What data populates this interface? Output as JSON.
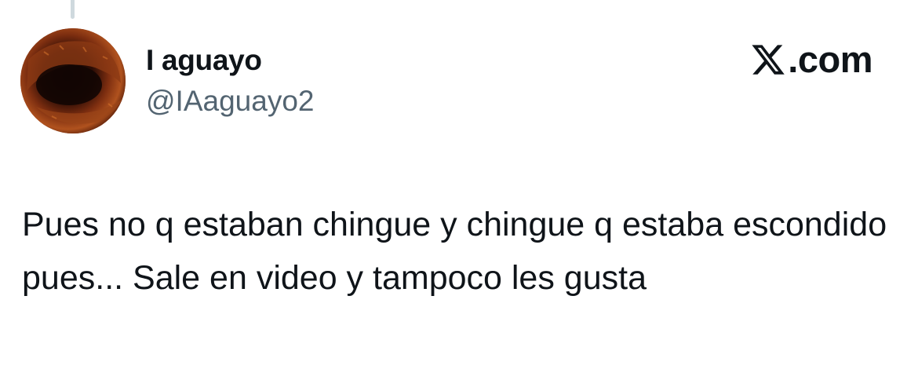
{
  "tweet": {
    "author": {
      "display_name": "I aguayo",
      "handle": "@IAaguayo2",
      "avatar_icon": "avatar-image"
    },
    "brand": {
      "logo_icon": "x-logo-icon",
      "suffix": ".com"
    },
    "text": "Pues no q estaban chingue y chingue q estaba escondido pues... Sale en video y tampoco les gusta"
  },
  "colors": {
    "text_primary": "#0f1419",
    "text_secondary": "#536471",
    "thread_line": "#cfd9de",
    "background": "#ffffff"
  }
}
